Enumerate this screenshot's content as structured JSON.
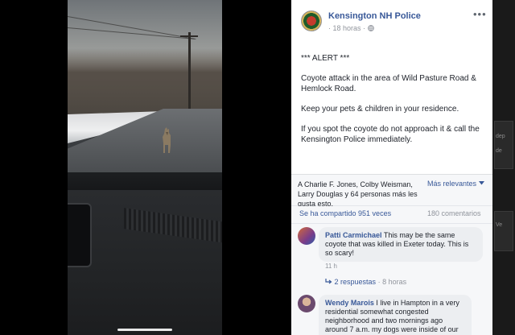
{
  "post": {
    "page_name": "Kensington NH Police",
    "time": "18 horas",
    "more_label": "•••",
    "body": [
      "*** ALERT ***",
      "Coyote attack in the area of Wild Pasture Road & Hemlock Road.",
      "Keep your pets & children in your residence.",
      "If you spot the coyote do not approach it & call the Kensington Police immediately."
    ],
    "likes_text": "A Charlie F. Jones, Colby Weisman, Larry Douglas y 64 personas más les gusta esto.",
    "sort_label": "Más relevantes",
    "shares_text": "Se ha compartido 951 veces",
    "comments_count": "180 comentarios"
  },
  "comments": [
    {
      "author": "Patti Carmichael",
      "text": "This may be the same coyote that was killed in Exeter today. This is so scary!",
      "time": "11 h",
      "replies": "2 respuestas",
      "replies_time": "8 horas"
    },
    {
      "author": "Wendy Marois",
      "text": "I live in Hampton in a very residential somewhat congested neighborhood and two mornings ago around 7 a.m. my dogs were inside of our"
    }
  ],
  "side_strip": {
    "labels": [
      "dep",
      "de",
      "Ve"
    ]
  },
  "colors": {
    "link": "#385898",
    "meta": "#90949c",
    "bubble": "#eceef1"
  }
}
